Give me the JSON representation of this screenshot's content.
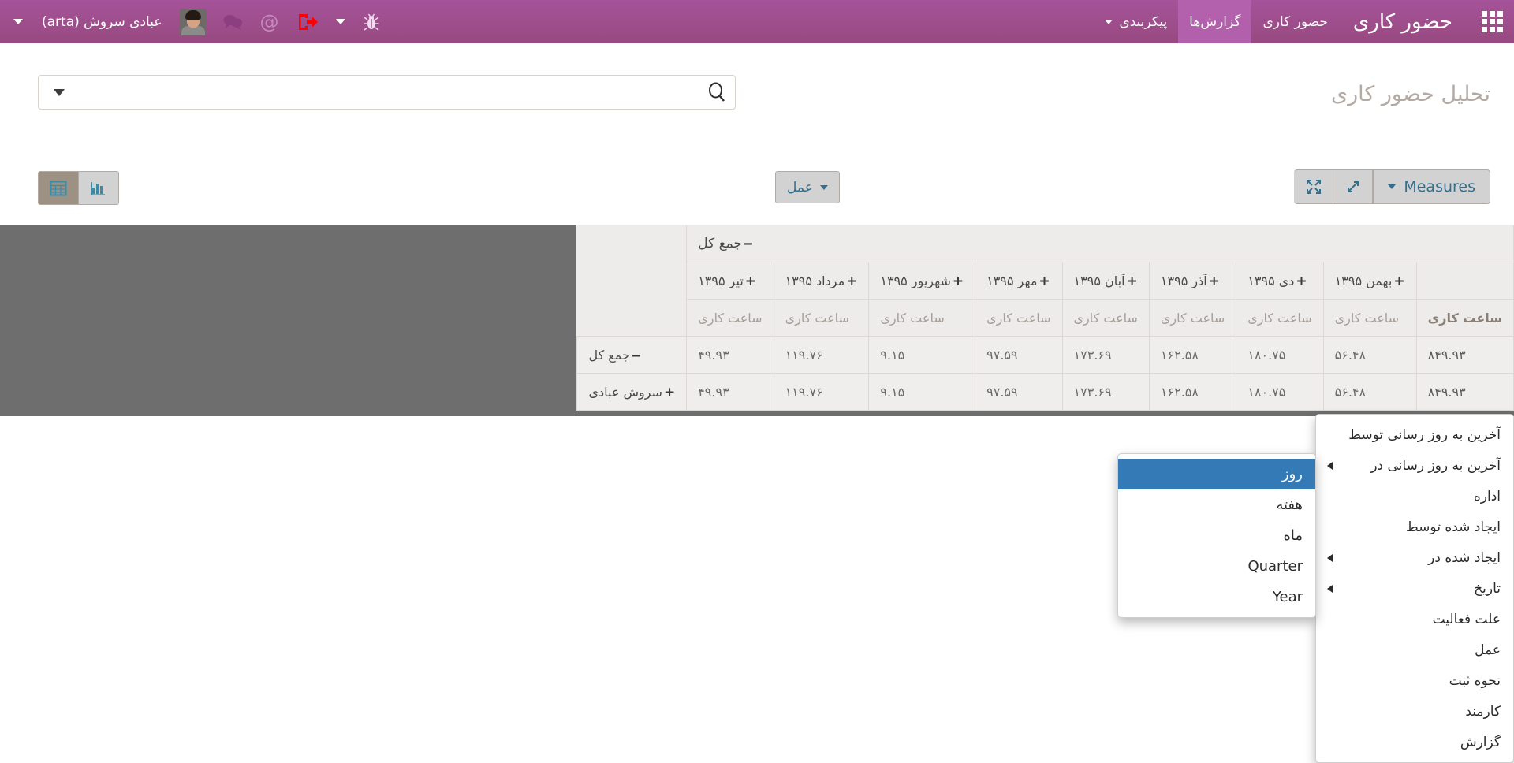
{
  "topbar": {
    "brand": "حضور کاری",
    "apps_icon": "apps-grid-icon",
    "menu": [
      {
        "label": "حضور کاری",
        "active": false,
        "caret": false
      },
      {
        "label": "گزارش‌ها",
        "active": true,
        "caret": false
      },
      {
        "label": "پیکربندی",
        "active": false,
        "caret": true
      }
    ],
    "user": {
      "name": "عبادی سروش (arta)",
      "avatar": "user-avatar"
    },
    "icons": {
      "bug": "bug-icon",
      "logout": "logout-icon",
      "mentions": "at-icon",
      "messages": "chat-bubbles-icon",
      "user_caret": "chevron-down-icon"
    },
    "colors": {
      "bar": "#a0508f",
      "active_menu": "#b461ae",
      "logout": "#ff0000"
    }
  },
  "page": {
    "title": "تحلیل حضور کاری"
  },
  "search": {
    "value": "",
    "placeholder": "",
    "caret_icon": "chevron-down-icon",
    "search_icon": "search-icon"
  },
  "view_toggle": {
    "buttons": [
      {
        "name": "pivot-view",
        "icon": "table-icon",
        "active": true
      },
      {
        "name": "graph-view",
        "icon": "bar-chart-icon",
        "active": false
      }
    ]
  },
  "toolbar": {
    "action_label": "عمل",
    "measures_label": "Measures",
    "expand_icon": "expand-diagonal-icon",
    "fullscreen_icon": "fullscreen-icon"
  },
  "pivot": {
    "grand_total_header": "جمع کل",
    "measure_label": "ساعت کاری",
    "columns": [
      {
        "label": "تیر ۱۳۹۵",
        "toggle": "+"
      },
      {
        "label": "مرداد ۱۳۹۵",
        "toggle": "+"
      },
      {
        "label": "شهریور ۱۳۹۵",
        "toggle": "+"
      },
      {
        "label": "مهر ۱۳۹۵",
        "toggle": "+"
      },
      {
        "label": "آبان ۱۳۹۵",
        "toggle": "+"
      },
      {
        "label": "آذر ۱۳۹۵",
        "toggle": "+"
      },
      {
        "label": "دی ۱۳۹۵",
        "toggle": "+"
      },
      {
        "label": "بهمن ۱۳۹۵",
        "toggle": "+"
      }
    ],
    "total_column_label": "",
    "rows": [
      {
        "label": "جمع کل",
        "toggle": "−",
        "values": [
          "۴۹.۹۳",
          "۱۱۹.۷۶",
          "۹.۱۵",
          "۹۷.۵۹",
          "۱۷۳.۶۹",
          "۱۶۲.۵۸",
          "۱۸۰.۷۵",
          "۵۶.۴۸"
        ],
        "total": "۸۴۹.۹۳"
      },
      {
        "label": "سروش عبادی",
        "toggle": "+",
        "values": [
          "۴۹.۹۳",
          "۱۱۹.۷۶",
          "۹.۱۵",
          "۹۷.۵۹",
          "۱۷۳.۶۹",
          "۱۶۲.۵۸",
          "۱۸۰.۷۵",
          "۵۶.۴۸"
        ],
        "total": "۸۴۹.۹۳"
      }
    ]
  },
  "group_menu": {
    "items": [
      {
        "label": "آخرین به روز رسانی توسط",
        "submenu": false
      },
      {
        "label": "آخرین به روز رسانی در",
        "submenu": true
      },
      {
        "label": "اداره",
        "submenu": false
      },
      {
        "label": "ایجاد شده توسط",
        "submenu": false
      },
      {
        "label": "ایجاد شده در",
        "submenu": true
      },
      {
        "label": "تاریخ",
        "submenu": true
      },
      {
        "label": "علت فعالیت",
        "submenu": false
      },
      {
        "label": "عمل",
        "submenu": false
      },
      {
        "label": "نحوه ثبت",
        "submenu": false
      },
      {
        "label": "کارمند",
        "submenu": false
      },
      {
        "label": "گزارش",
        "submenu": false
      }
    ]
  },
  "period_submenu": {
    "items": [
      {
        "label": "روز",
        "selected": true
      },
      {
        "label": "هفته",
        "selected": false
      },
      {
        "label": "ماه",
        "selected": false
      },
      {
        "label": "Quarter",
        "selected": false
      },
      {
        "label": "Year",
        "selected": false
      }
    ],
    "highlight_color": "#337ab7"
  }
}
